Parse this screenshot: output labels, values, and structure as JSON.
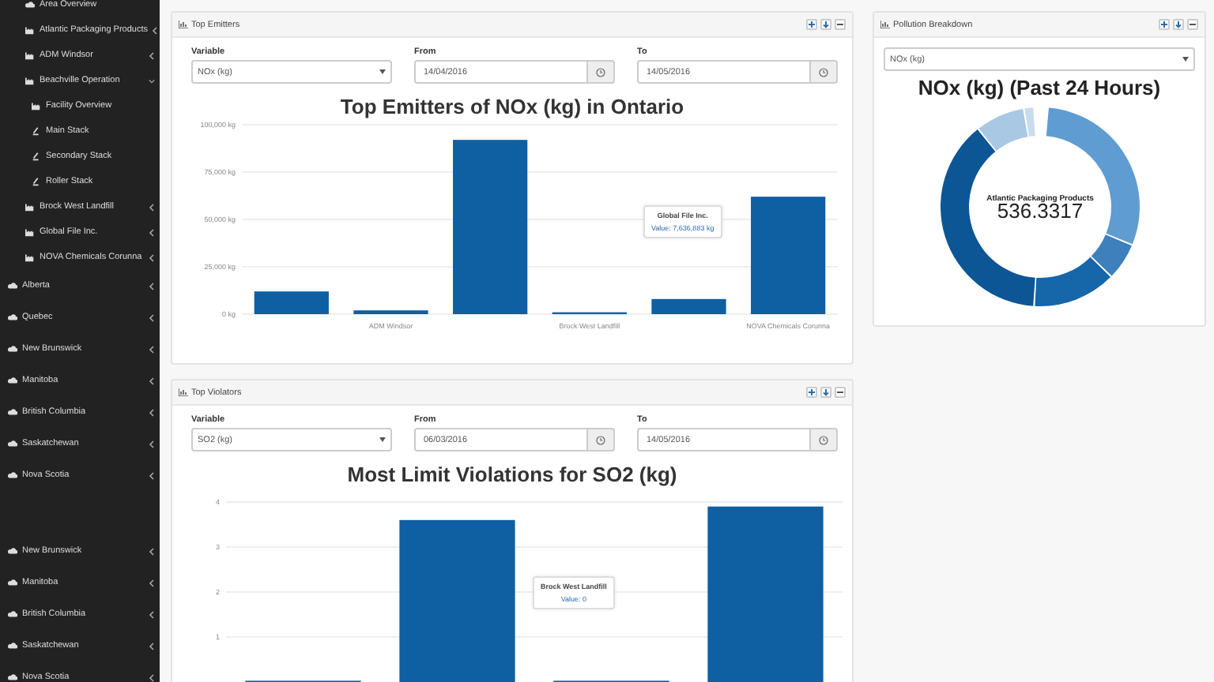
{
  "sidebar": {
    "facility_items": [
      {
        "label": "Area Overview",
        "kind": "cloud"
      },
      {
        "label": "Atlantic Packaging Products",
        "kind": "factory",
        "expanded": false
      },
      {
        "label": "ADM Windsor",
        "kind": "factory",
        "expanded": false
      },
      {
        "label": "Beachville Operation",
        "kind": "factory",
        "expanded": true,
        "children": [
          {
            "label": "Facility Overview",
            "kind": "factory"
          },
          {
            "label": "Main Stack",
            "kind": "stack"
          },
          {
            "label": "Secondary Stack",
            "kind": "stack"
          },
          {
            "label": "Roller Stack",
            "kind": "stack"
          }
        ]
      },
      {
        "label": "Brock West Landfill",
        "kind": "factory",
        "expanded": false
      },
      {
        "label": "Global File Inc.",
        "kind": "factory",
        "expanded": false
      },
      {
        "label": "NOVA Chemicals Corunna",
        "kind": "factory",
        "expanded": false
      }
    ],
    "region_items": [
      {
        "label": "Alberta",
        "expanded": false
      },
      {
        "label": "Quebec",
        "expanded": false
      },
      {
        "label": "New Brunswick",
        "expanded": false
      },
      {
        "label": "Manitoba",
        "expanded": false
      },
      {
        "label": "British Columbia",
        "expanded": false
      },
      {
        "label": "Saskatchewan",
        "expanded": false
      },
      {
        "label": "Nova Scotia",
        "expanded": false
      }
    ],
    "region_items_2": [
      {
        "label": "New Brunswick",
        "expanded": false
      },
      {
        "label": "Manitoba",
        "expanded": false
      },
      {
        "label": "British Columbia",
        "expanded": false
      },
      {
        "label": "Saskatchewan",
        "expanded": false
      },
      {
        "label": "Nova Scotia",
        "expanded": false
      }
    ]
  },
  "top_emitters": {
    "title": "Top Emitters",
    "variable": {
      "label": "Variable",
      "value": "NOx (kg)"
    },
    "from": {
      "label": "From",
      "value": "14/04/2016"
    },
    "to": {
      "label": "To",
      "value": "14/05/2016"
    },
    "chart_data": {
      "type": "bar",
      "title": "Top Emitters of NOx (kg) in Ontario",
      "categories": [
        null,
        "ADM Windsor",
        null,
        "Brock West Landfill",
        null,
        "NOVA Chemicals Corunna"
      ],
      "series": [
        {
          "color": "#0f5fa3",
          "values": [
            12000,
            2000,
            92000,
            1000,
            8000,
            62000
          ]
        }
      ],
      "grid": true,
      "ylim": [
        0,
        100000
      ],
      "yticks": [
        {
          "value": 0,
          "label": "0 kg"
        },
        {
          "value": 25000,
          "label": "25,000 kg"
        },
        {
          "value": 50000,
          "label": "50,000 kg"
        },
        {
          "value": 75000,
          "label": "75,000 kg"
        },
        {
          "value": 100000,
          "label": "100,000 kg"
        }
      ],
      "annotations": [
        {
          "text": "Global File Inc."
        },
        {
          "text": "Value: 7,636,883 kg"
        }
      ]
    }
  },
  "top_violators": {
    "title": "Top Violators",
    "variable": {
      "label": "Variable",
      "value": "SO2 (kg)"
    },
    "from": {
      "label": "From",
      "value": "06/03/2016"
    },
    "to": {
      "label": "To",
      "value": "14/05/2016"
    },
    "chart_data": {
      "type": "bar",
      "title": "Most Limit Violations for SO2 (kg)",
      "series": [
        {
          "color": "#0f5fa3",
          "values": [
            0,
            3.6,
            0,
            3.9
          ]
        }
      ],
      "grid": true,
      "ylim": [
        0,
        4
      ],
      "yticks": [
        1,
        2,
        3,
        4
      ],
      "annotations": [
        {
          "text": "Brock West Landfill"
        },
        {
          "text": "Value: 0"
        }
      ]
    }
  },
  "pollution_breakdown": {
    "title": "Pollution Breakdown",
    "variable": "NOx (kg)",
    "chart_title": "NOx (kg) (Past 24 Hours)",
    "center_label": "Atlantic Packaging Products",
    "center_value": "536.3317"
  }
}
